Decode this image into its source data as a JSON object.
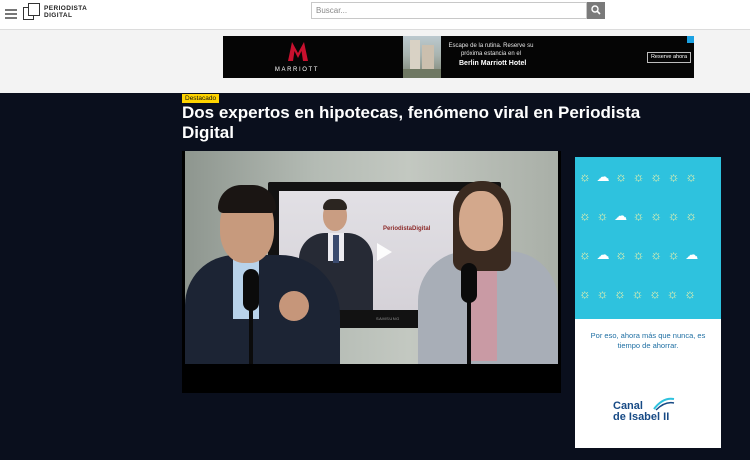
{
  "header": {
    "logo": "PERIODISTA DIGITAL",
    "search": {
      "placeholder": "Buscar..."
    }
  },
  "top_ad": {
    "brand": "MARRIOTT",
    "tagline": "Escape de la rutina. Reserve su próxima estancia en el",
    "hotel": "Berlin Marriott Hotel",
    "cta": "Reserve ahora"
  },
  "article": {
    "badge": "Destacado",
    "headline": "Dos expertos en hipotecas, fenómeno viral en Periodista Digital"
  },
  "video": {
    "inset_logo": "PeriodistaDigital",
    "tv_brand": "SAMSUNG"
  },
  "side_ad": {
    "copy": "Por eso, ahora más que nunca, es tiempo de ahorrar.",
    "brand_line1": "Canal",
    "brand_line2": "de Isabel II"
  },
  "colors": {
    "page_bg": "#0a0f1d",
    "badge": "#ffd400",
    "side_ad_bg": "#2ec2de",
    "marriott_red": "#c8102e"
  }
}
